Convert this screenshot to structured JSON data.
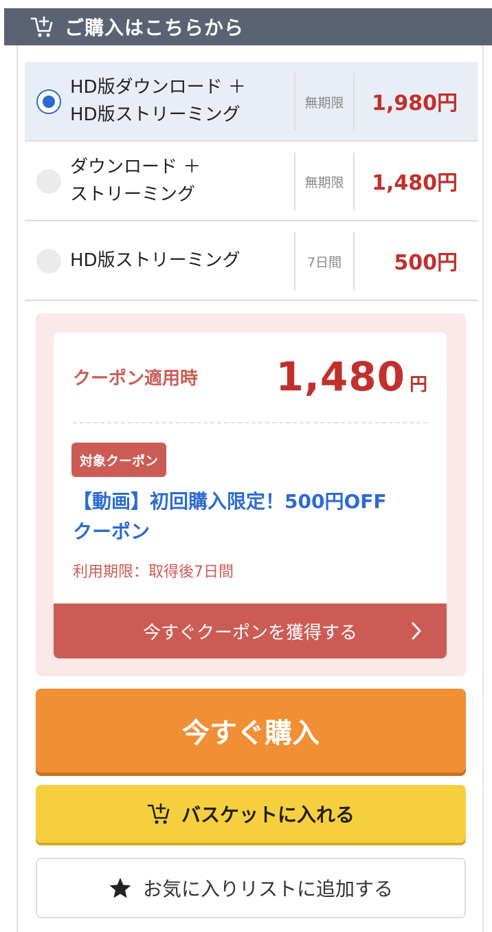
{
  "header": {
    "title": "ご購入はこちらから",
    "icon": "cart-plus-icon"
  },
  "options": [
    {
      "line1": "HD版ダウンロード ＋",
      "line2": "HD版ストリーミング",
      "period": "無期限",
      "price": "1,980円",
      "selected": true
    },
    {
      "line1": "ダウンロード ＋",
      "line2": "ストリーミング",
      "period": "無期限",
      "price": "1,480円",
      "selected": false
    },
    {
      "line1": "HD版ストリーミング",
      "line2": "",
      "period": "7日間",
      "price": "500円",
      "selected": false
    }
  ],
  "coupon": {
    "label": "クーポン適用時",
    "price_number": "1,480",
    "price_unit": "円",
    "badge": "対象クーポン",
    "name_line1": "【動画】初回購入限定！500円OFF",
    "name_line2": "クーポン",
    "expiry": "利用期限：取得後7日間",
    "get_button": "今すぐクーポンを獲得する"
  },
  "buttons": {
    "buy_now": "今すぐ購入",
    "add_to_basket": "バスケットに入れる",
    "add_to_favorites": "お気に入りリストに追加する"
  },
  "colors": {
    "header_bg": "#5b6273",
    "selected_bg": "#e9eef6",
    "price_red": "#c0312c",
    "coupon_red": "#cd5b55",
    "coupon_bg": "#fbe8e8",
    "link_blue": "#2c6bd1",
    "buy_orange": "#f08f34",
    "basket_yellow": "#f6cf3f"
  }
}
